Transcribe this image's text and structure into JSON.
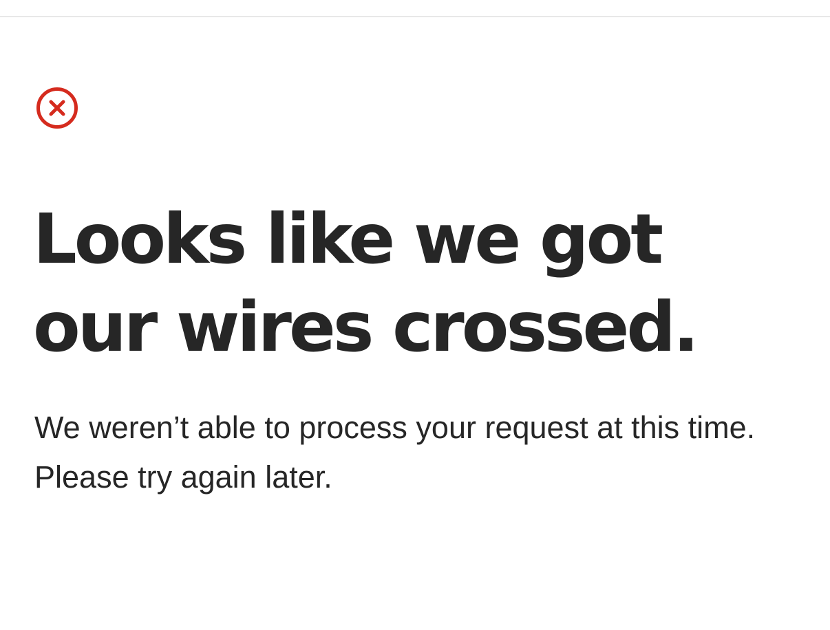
{
  "icon": {
    "name": "error-circle-x-icon",
    "color": "#d52b1e"
  },
  "error": {
    "headline": "Looks like we got our wires crossed.",
    "message": "We weren’t able to process your request at this time. Please try again later."
  },
  "colors": {
    "text": "#262626",
    "background": "#ffffff",
    "divider": "#d0d0d0"
  }
}
